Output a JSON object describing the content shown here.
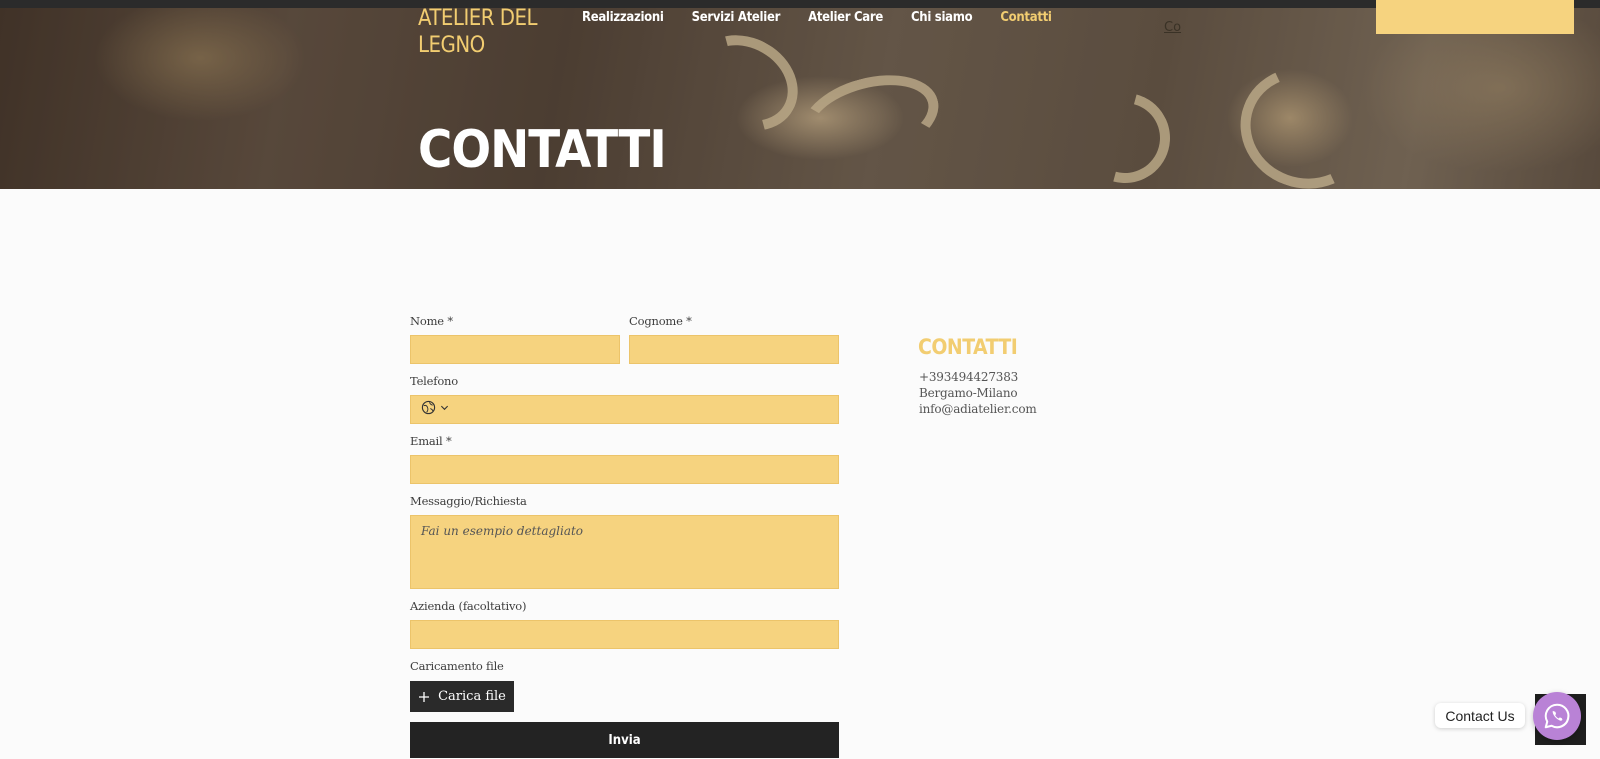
{
  "header": {
    "logo": "ATELIER DEL LEGNO",
    "nav": [
      {
        "label": "Realizzazioni"
      },
      {
        "label": "Servizi Atelier"
      },
      {
        "label": "Atelier Care"
      },
      {
        "label": "Chi siamo"
      },
      {
        "label": "Contatti",
        "active": true
      }
    ],
    "clipped_link": "Co"
  },
  "hero": {
    "title": "CONTATTI"
  },
  "form": {
    "first_name_label": "Nome *",
    "last_name_label": "Cognome *",
    "phone_label": "Telefono",
    "email_label": "Email *",
    "message_label": "Messaggio/Richiesta",
    "message_placeholder": "Fai un esempio dettagliato",
    "company_label": "Azienda (facoltativo)",
    "upload_label": "Caricamento file",
    "upload_button": "Carica file",
    "submit_button": "Invia"
  },
  "contact_info": {
    "title": "CONTATTI",
    "phone": "+393494427383",
    "location": "Bergamo-Milano",
    "email": "info@adiatelier.com"
  },
  "widget": {
    "chip_label": "Contact Us"
  },
  "colors": {
    "accent": "#f6d37f",
    "title_gold": "#f2cd71",
    "dark": "#232323",
    "whatsapp_bubble": "#b982d6"
  },
  "icons": [
    "globe-icon",
    "chevron-down-icon",
    "plus-icon",
    "whatsapp-icon"
  ]
}
